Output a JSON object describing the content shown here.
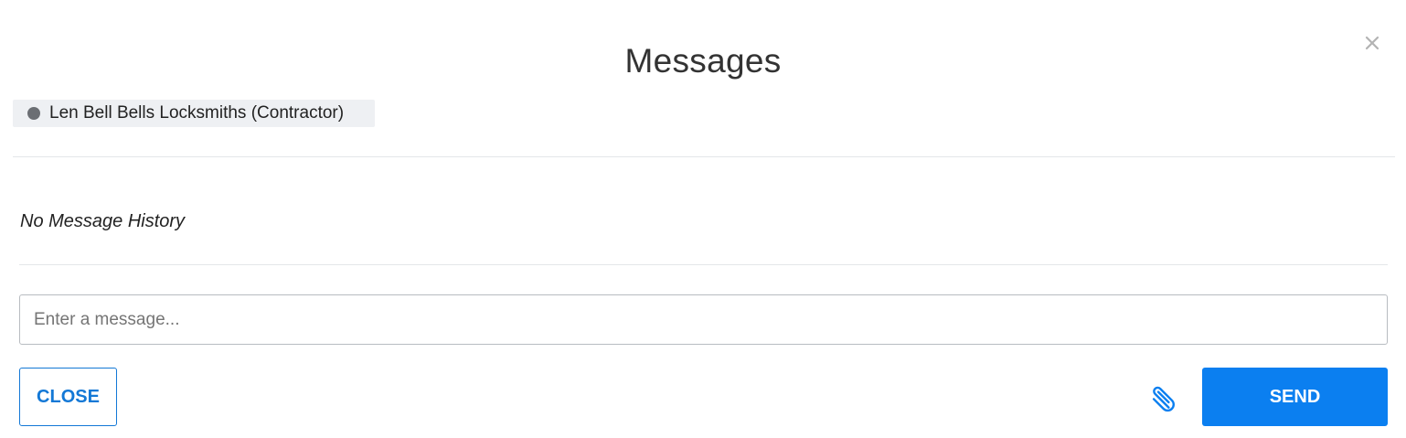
{
  "modal": {
    "title": "Messages",
    "close_icon": "close-x-icon"
  },
  "contact": {
    "label": "Len Bell Bells Locksmiths (Contractor)",
    "status_icon": "status-dot-icon",
    "status_color": "#6b6e73"
  },
  "history": {
    "empty_text": "No Message History"
  },
  "composer": {
    "value": "",
    "placeholder": "Enter a message...",
    "attach_icon": "paperclip-icon"
  },
  "actions": {
    "close_label": "CLOSE",
    "send_label": "SEND"
  },
  "colors": {
    "accent": "#0b7ff0",
    "outline_accent": "#1378d6",
    "chip_background": "#eef0f3",
    "divider": "#e4e6e9"
  }
}
